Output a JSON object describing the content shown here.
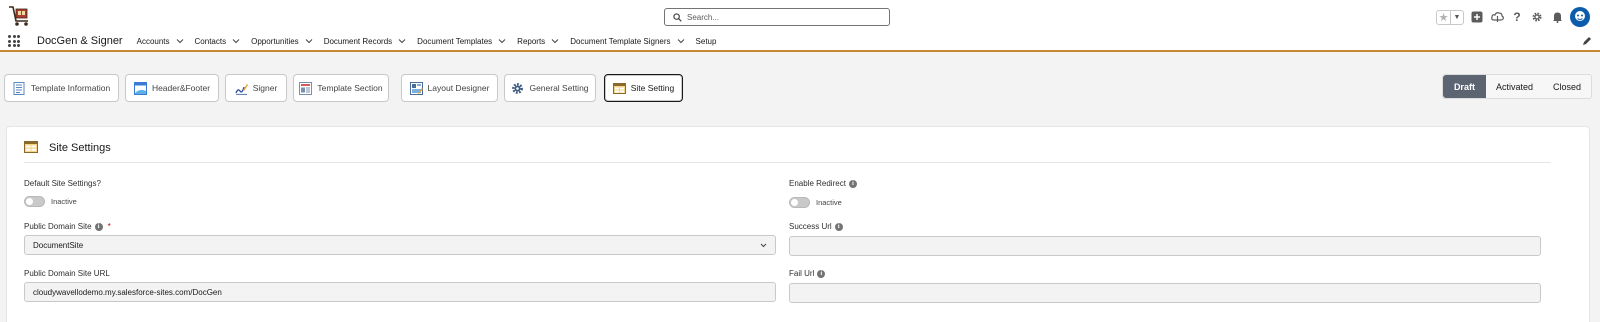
{
  "header": {
    "search_placeholder": "Search..."
  },
  "nav": {
    "app_name": "DocGen & Signer",
    "items": [
      {
        "label": "Accounts"
      },
      {
        "label": "Contacts"
      },
      {
        "label": "Opportunities"
      },
      {
        "label": "Document Records"
      },
      {
        "label": "Document Templates"
      },
      {
        "label": "Reports"
      },
      {
        "label": "Document Template Signers"
      },
      {
        "label": "Setup"
      }
    ]
  },
  "tabs": [
    {
      "label": "Template Information",
      "icon": "template-info-icon"
    },
    {
      "label": "Header&Footer",
      "icon": "header-footer-icon"
    },
    {
      "label": "Signer",
      "icon": "signer-icon"
    },
    {
      "label": "Template Section",
      "icon": "template-section-icon"
    },
    {
      "label": "Layout Designer",
      "icon": "layout-designer-icon"
    },
    {
      "label": "General Setting",
      "icon": "gear-icon"
    },
    {
      "label": "Site Setting",
      "icon": "site-setting-icon",
      "active": true
    }
  ],
  "status": {
    "options": [
      "Draft",
      "Activated",
      "Closed"
    ],
    "active": "Draft"
  },
  "site_settings": {
    "title": "Site Settings",
    "default_site_settings": {
      "label": "Default Site Settings?",
      "state": "Inactive"
    },
    "enable_redirect": {
      "label": "Enable Redirect",
      "state": "Inactive"
    },
    "public_domain_site": {
      "label": "Public Domain Site",
      "required_mark": "*",
      "value": "DocumentSite"
    },
    "success_url": {
      "label": "Success Url",
      "value": ""
    },
    "public_domain_site_url": {
      "label": "Public Domain Site URL",
      "value": "cloudywavellodemo.my.salesforce-sites.com/DocGen"
    },
    "fail_url": {
      "label": "Fail Url",
      "value": ""
    }
  },
  "colors": {
    "nav_underline": "#c7882f",
    "status_active_bg": "#5c6472",
    "avatar": "#0b5cab"
  }
}
